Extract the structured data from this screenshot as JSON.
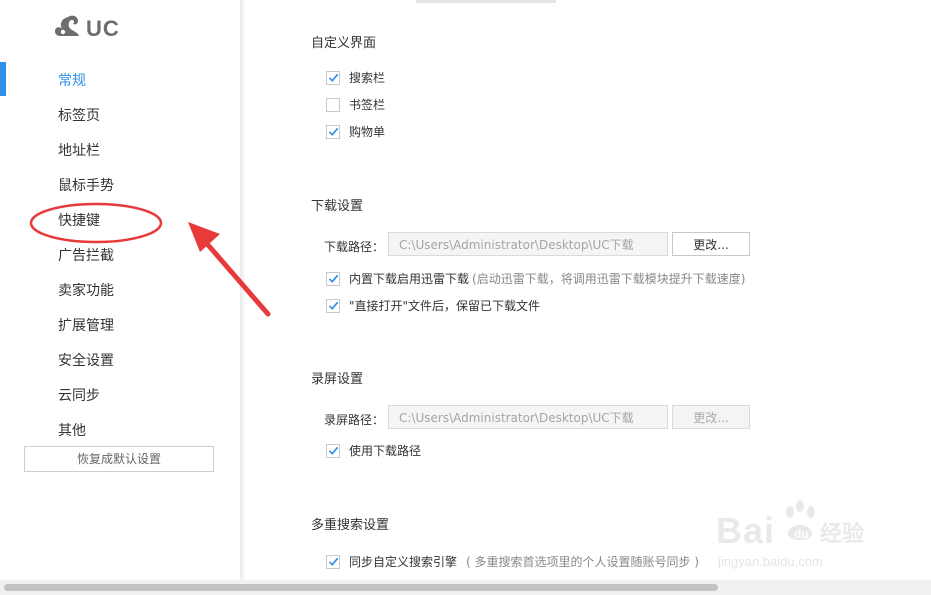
{
  "app": {
    "logo_text": "UC"
  },
  "sidebar": {
    "items": [
      {
        "label": "常规",
        "active": true
      },
      {
        "label": "标签页"
      },
      {
        "label": "地址栏"
      },
      {
        "label": "鼠标手势"
      },
      {
        "label": "快捷键"
      },
      {
        "label": "广告拦截"
      },
      {
        "label": "卖家功能"
      },
      {
        "label": "扩展管理"
      },
      {
        "label": "安全设置"
      },
      {
        "label": "云同步"
      },
      {
        "label": "其他"
      }
    ],
    "reset_label": "恢复成默认设置"
  },
  "sections": {
    "custom_ui": {
      "title": "自定义界面",
      "options": [
        {
          "label": "搜索栏",
          "checked": true
        },
        {
          "label": "书签栏",
          "checked": false
        },
        {
          "label": "购物单",
          "checked": true
        }
      ]
    },
    "download": {
      "title": "下载设置",
      "path_label": "下载路径：",
      "path_value": "C:\\Users\\Administrator\\Desktop\\UC下载",
      "change_label": "更改...",
      "opt1_label": "内置下载启用迅雷下载",
      "opt1_hint": "(启动迅雷下载，将调用迅雷下载模块提升下载速度)",
      "opt1_checked": true,
      "opt2_label": "\"直接打开\"文件后，保留已下载文件",
      "opt2_checked": true
    },
    "record": {
      "title": "录屏设置",
      "path_label": "录屏路径：",
      "path_value": "C:\\Users\\Administrator\\Desktop\\UC下载",
      "change_label": "更改...",
      "opt_label": "使用下载路径",
      "opt_checked": true
    },
    "multi_search": {
      "title": "多重搜索设置",
      "opt_label": "同步自定义搜索引擎",
      "opt_hint": "( 多重搜索首选项里的个人设置随账号同步 )",
      "opt_checked": true
    }
  },
  "watermark": {
    "brand": "Bai",
    "brand2": "经验",
    "url": "jingyan.baidu.com"
  },
  "colors": {
    "accent": "#2f8fe8",
    "annotation": "#e83a3a"
  },
  "icons": {
    "logo": "uc-squirrel-icon",
    "check": "check-icon"
  }
}
